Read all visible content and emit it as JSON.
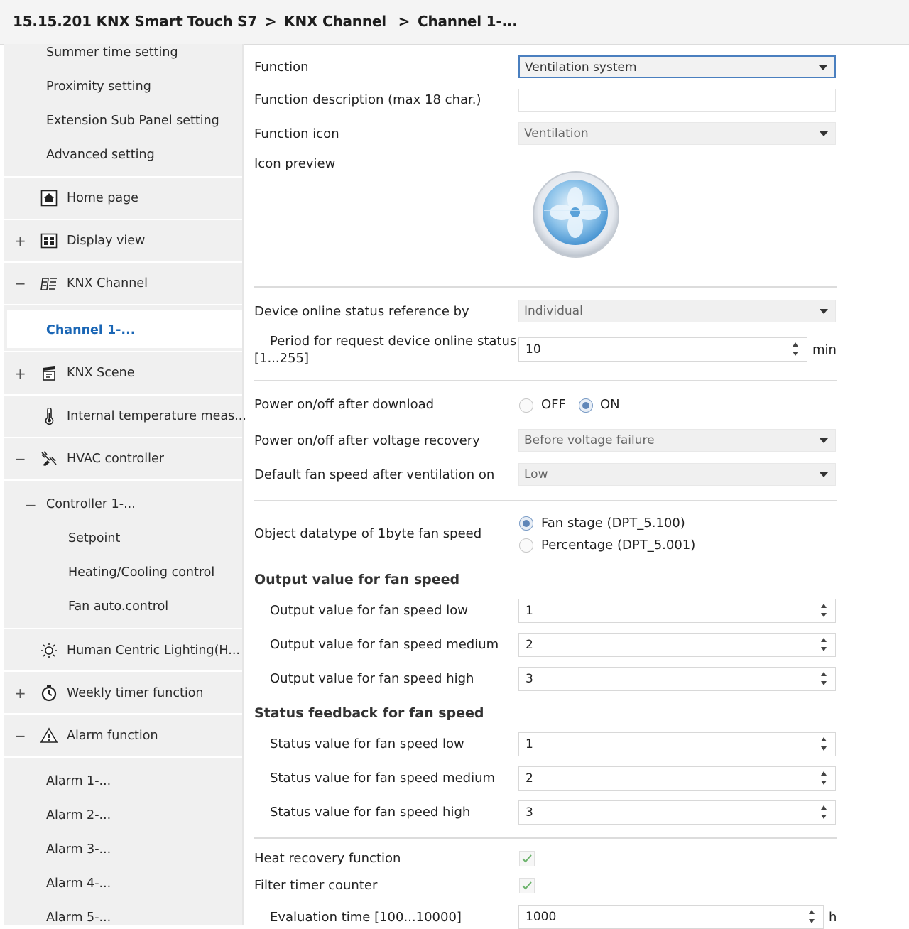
{
  "header": {
    "crumbs": [
      "15.15.201 KNX Smart Touch S7",
      ">",
      "KNX Channel",
      ">",
      "Channel 1-..."
    ]
  },
  "sidebar": {
    "sub_items_top": [
      "Summer time setting",
      "Proximity setting",
      "Extension Sub Panel setting",
      "Advanced setting"
    ],
    "home_page": "Home page",
    "display_view": "Display view",
    "knx_channel": "KNX Channel",
    "channel_1": "Channel 1-...",
    "knx_scene": "KNX Scene",
    "internal_temp": "Internal temperature meas...",
    "hvac_controller": "HVAC controller",
    "controller_1": "Controller 1-...",
    "setpoint": "Setpoint",
    "heating_cooling": "Heating/Cooling control",
    "fan_auto": "Fan auto.control",
    "hcl": "Human Centric Lighting(H...",
    "weekly_timer": "Weekly timer function",
    "alarm_function": "Alarm function",
    "alarms": [
      "Alarm 1-...",
      "Alarm 2-...",
      "Alarm 3-...",
      "Alarm 4-...",
      "Alarm 5-..."
    ],
    "plus": "+",
    "minus": "−"
  },
  "form": {
    "function_label": "Function",
    "function_value": "Ventilation system",
    "description_label": "Function description (max 18 char.)",
    "description_value": "",
    "icon_label": "Function icon",
    "icon_value": "Ventilation",
    "preview_label": "Icon preview",
    "online_ref_label": "Device online status reference by",
    "online_ref_value": "Individual",
    "period_label_1": "Period for request device online status",
    "period_label_2": "[1...255]",
    "period_value": "10",
    "period_unit": "min",
    "power_download_label": "Power on/off after download",
    "power_download_off": "OFF",
    "power_download_on": "ON",
    "power_recovery_label": "Power on/off after voltage recovery",
    "power_recovery_value": "Before voltage failure",
    "default_fan_label": "Default fan speed after ventilation on",
    "default_fan_value": "Low",
    "datatype_label": "Object datatype of 1byte fan speed",
    "datatype_opt1": "Fan stage (DPT_5.100)",
    "datatype_opt2": "Percentage (DPT_5.001)",
    "output_heading": "Output value for fan speed",
    "output_low_label": "Output value for fan speed low",
    "output_low_value": "1",
    "output_med_label": "Output value for fan speed medium",
    "output_med_value": "2",
    "output_high_label": "Output value for fan speed high",
    "output_high_value": "3",
    "status_heading": "Status feedback for fan speed",
    "status_low_label": "Status value for fan speed low",
    "status_low_value": "1",
    "status_med_label": "Status value for fan speed medium",
    "status_med_value": "2",
    "status_high_label": "Status value for fan speed high",
    "status_high_value": "3",
    "heat_recovery_label": "Heat recovery function",
    "filter_timer_label": "Filter timer counter",
    "eval_time_label": "Evaluation time [100...10000]",
    "eval_time_value": "1000",
    "eval_time_unit": "h"
  }
}
